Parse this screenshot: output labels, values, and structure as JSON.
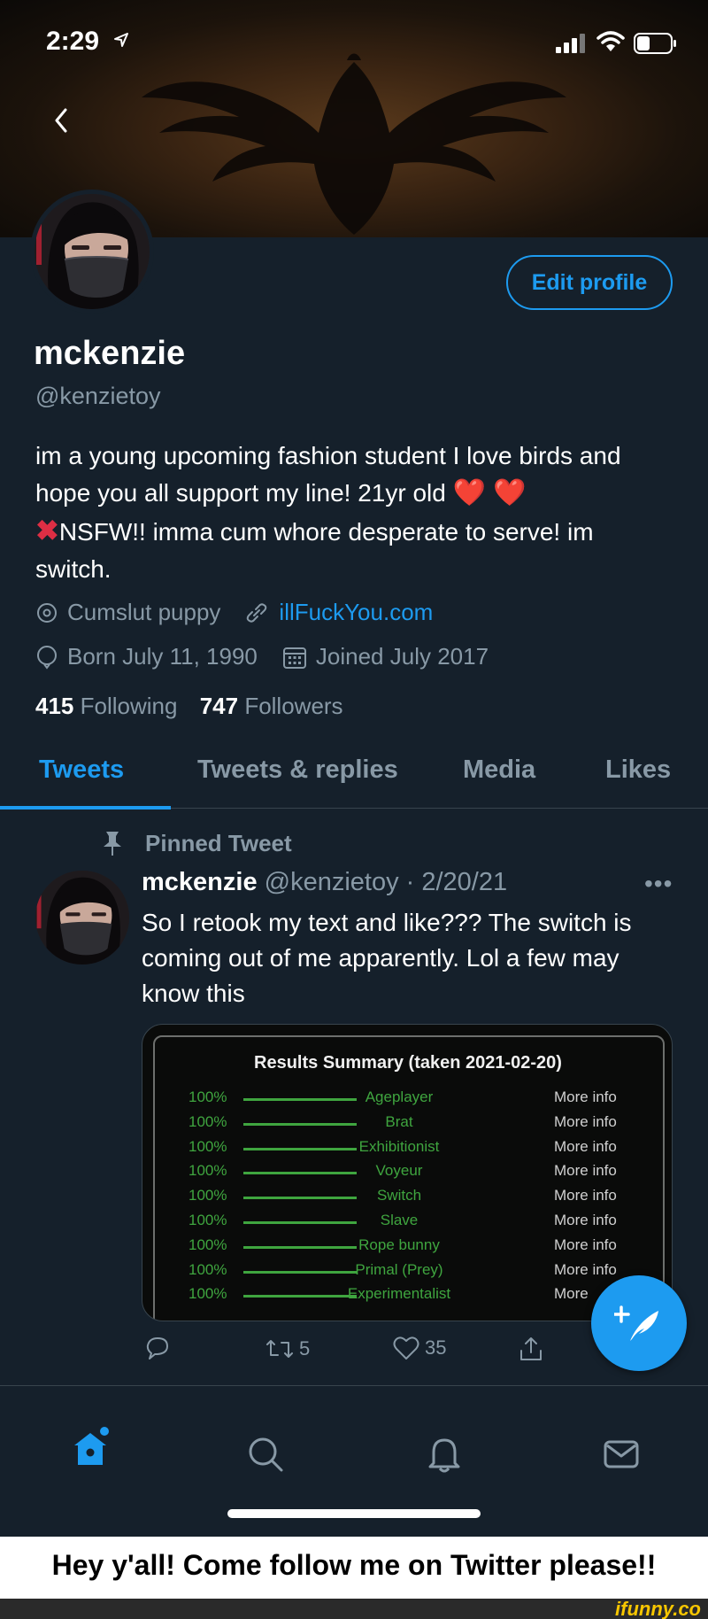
{
  "status": {
    "time": "2:29"
  },
  "profile": {
    "edit_label": "Edit profile",
    "name": "mckenzie",
    "handle": "@kenzietoy",
    "bio_line1": "im a young upcoming fashion student I love birds and hope you all support my line! 21yr old",
    "bio_hearts": "❤️ ❤️",
    "bio_x": "✖",
    "bio_line2": "NSFW!! imma cum whore desperate to serve! im switch.",
    "location": "Cumslut puppy",
    "website": "illFuckYou.com",
    "birthday": "Born July 11, 1990",
    "joined": "Joined July 2017",
    "following_count": "415",
    "following_label": "Following",
    "followers_count": "747",
    "followers_label": "Followers"
  },
  "tabs": [
    "Tweets",
    "Tweets & replies",
    "Media",
    "Likes"
  ],
  "tweet": {
    "pinned_label": "Pinned Tweet",
    "name": "mckenzie",
    "meta": "@kenzietoy · 2/20/21",
    "more": "•••",
    "text": "So I retook my text and like??? The switch is coming out of me apparently. Lol a few may know this",
    "image": {
      "title": "Results Summary (taken 2021-02-20)",
      "rows": [
        {
          "pct": "100%",
          "cat": "Ageplayer",
          "more": "More info"
        },
        {
          "pct": "100%",
          "cat": "Brat",
          "more": "More info"
        },
        {
          "pct": "100%",
          "cat": "Exhibitionist",
          "more": "More info"
        },
        {
          "pct": "100%",
          "cat": "Voyeur",
          "more": "More info"
        },
        {
          "pct": "100%",
          "cat": "Switch",
          "more": "More info"
        },
        {
          "pct": "100%",
          "cat": "Slave",
          "more": "More info"
        },
        {
          "pct": "100%",
          "cat": "Rope bunny",
          "more": "More info"
        },
        {
          "pct": "100%",
          "cat": "Primal (Prey)",
          "more": "More info"
        },
        {
          "pct": "100%",
          "cat": "Experimentalist",
          "more": "More"
        }
      ]
    },
    "retweets": "5",
    "likes": "35"
  },
  "caption": "Hey y'all! Come follow me on Twitter please!!",
  "watermark": "ifunny.co",
  "colors": {
    "accent": "#1d9bf0",
    "background": "#15202b",
    "muted": "#8899a6",
    "result_green": "#3fa53f"
  }
}
